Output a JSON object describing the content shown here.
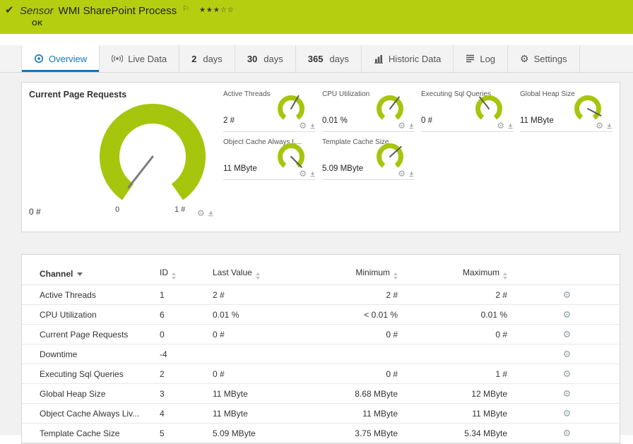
{
  "colors": {
    "banner_green": "#b5ce10",
    "gauge_green": "#a6c50d",
    "active_tab_blue": "#1377be"
  },
  "banner": {
    "sensor_prefix": "Sensor",
    "title": "WMI SharePoint Process",
    "status": "OK",
    "stars": "★★★☆☆",
    "check_icon": "✔",
    "flag_icon": "⚐"
  },
  "tabs": [
    {
      "label": "Overview",
      "active": true
    },
    {
      "label": "Live Data"
    },
    {
      "num": "2",
      "unit": "days"
    },
    {
      "num": "30",
      "unit": "days"
    },
    {
      "num": "365",
      "unit": "days"
    },
    {
      "label": "Historic Data"
    },
    {
      "label": "Log"
    },
    {
      "label": "Settings"
    }
  ],
  "chart_data": [
    {
      "type": "gauge",
      "title": "Current Page Requests",
      "value": 0,
      "unit": "#",
      "value_label": "0 #",
      "scale_min_label": "0",
      "scale_max_label": "1 #",
      "min": 0,
      "max": 1,
      "needle_deg": 218
    },
    {
      "type": "gauge",
      "title": "Active Threads",
      "value": 2,
      "unit": "#",
      "value_label": "2 #",
      "needle_deg": 30
    },
    {
      "type": "gauge",
      "title": "CPU Utilization",
      "value": 0.01,
      "unit": "%",
      "value_label": "0.01 %",
      "needle_deg": 38
    },
    {
      "type": "gauge",
      "title": "Executing Sql Queries",
      "value": 0,
      "unit": "#",
      "value_label": "0 #",
      "needle_deg": -38
    },
    {
      "type": "gauge",
      "title": "Global Heap Size",
      "value": 11,
      "unit": "MByte",
      "value_label": "11 MByte",
      "needle_deg": 118
    },
    {
      "type": "gauge",
      "title": "Object Cache Always L...",
      "value": 11,
      "unit": "MByte",
      "value_label": "11 MByte",
      "needle_deg": 135
    },
    {
      "type": "gauge",
      "title": "Template Cache Size",
      "value": 5.09,
      "unit": "MByte",
      "value_label": "5.09 MByte",
      "needle_deg": 48
    }
  ],
  "table": {
    "columns": [
      "Channel",
      "ID",
      "Last Value",
      "Minimum",
      "Maximum"
    ],
    "rows": [
      {
        "channel": "Active Threads",
        "id": "1",
        "last": "2 #",
        "min": "2 #",
        "max": "2 #"
      },
      {
        "channel": "CPU Utilization",
        "id": "6",
        "last": "0.01 %",
        "min": "< 0.01 %",
        "max": "0.01 %"
      },
      {
        "channel": "Current Page Requests",
        "id": "0",
        "last": "0 #",
        "min": "0 #",
        "max": "0 #"
      },
      {
        "channel": "Downtime",
        "id": "-4",
        "last": "",
        "min": "",
        "max": ""
      },
      {
        "channel": "Executing Sql Queries",
        "id": "2",
        "last": "0 #",
        "min": "0 #",
        "max": "1 #"
      },
      {
        "channel": "Global Heap Size",
        "id": "3",
        "last": "11 MByte",
        "min": "8.68 MByte",
        "max": "12 MByte"
      },
      {
        "channel": "Object Cache Always Liv...",
        "id": "4",
        "last": "11 MByte",
        "min": "11 MByte",
        "max": "11 MByte"
      },
      {
        "channel": "Template Cache Size",
        "id": "5",
        "last": "5.09 MByte",
        "min": "3.75 MByte",
        "max": "5.34 MByte"
      }
    ]
  }
}
